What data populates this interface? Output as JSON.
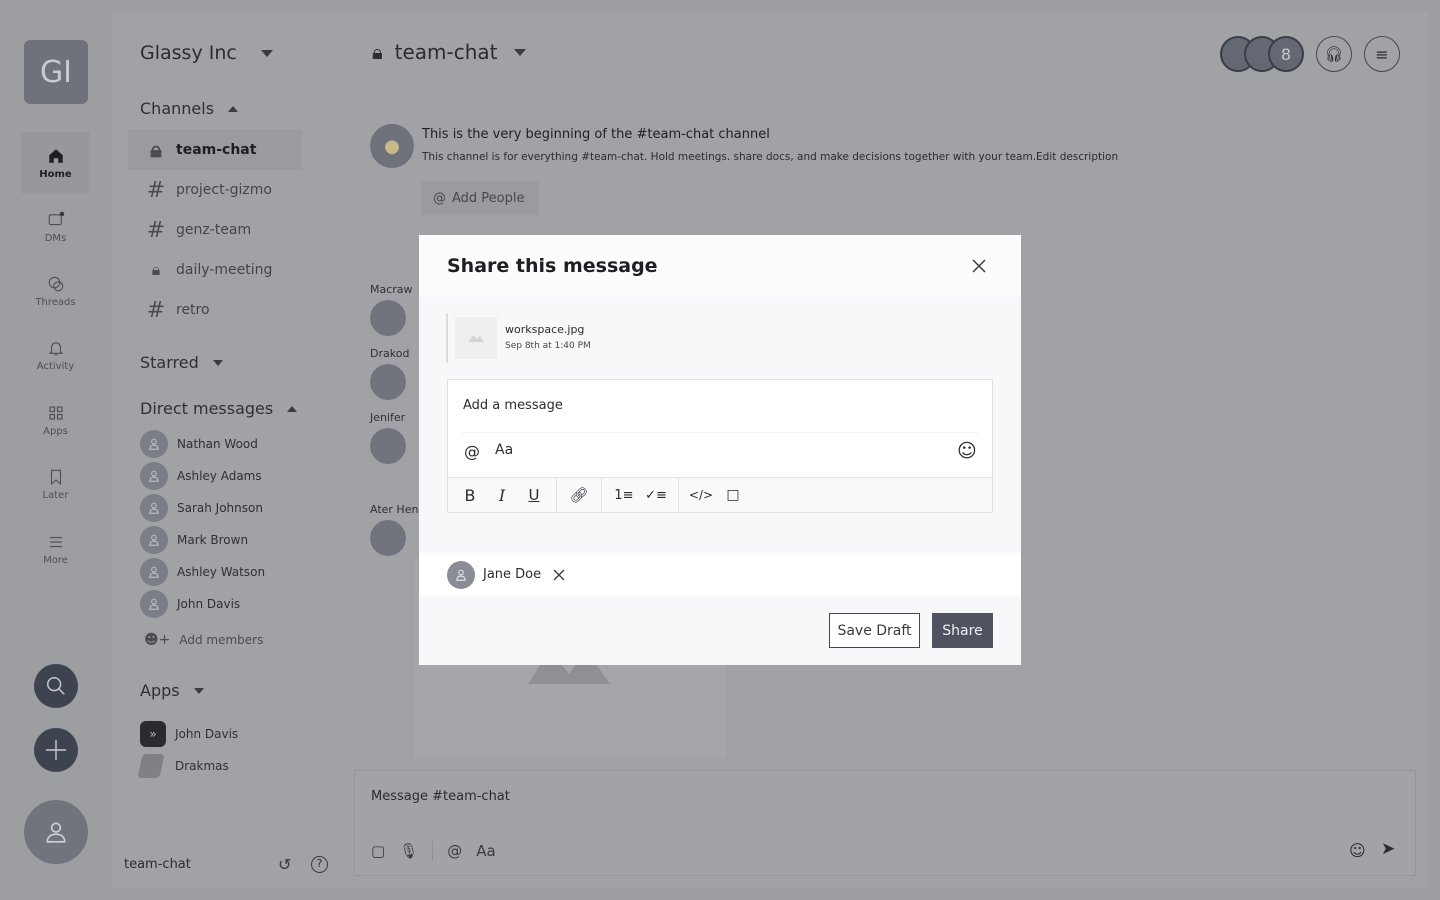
{
  "workspace": {
    "initials": "GI",
    "name": "Glassy Inc"
  },
  "rail": [
    {
      "label": "Home",
      "icon": "home-icon"
    },
    {
      "label": "DMs",
      "icon": "dm-icon"
    },
    {
      "label": "Threads",
      "icon": "threads-icon"
    },
    {
      "label": "Activity",
      "icon": "bell-icon"
    },
    {
      "label": "Apps",
      "icon": "apps-icon"
    },
    {
      "label": "Later",
      "icon": "bookmark-icon"
    },
    {
      "label": "More",
      "icon": "menu-icon"
    }
  ],
  "sidebar": {
    "channels_label": "Channels",
    "channels": [
      {
        "name": "team-chat",
        "private": true
      },
      {
        "name": "project-gizmo",
        "private": false
      },
      {
        "name": "genz-team",
        "private": false
      },
      {
        "name": "daily-meeting",
        "private": true
      },
      {
        "name": "retro",
        "private": false
      }
    ],
    "starred_label": "Starred",
    "dm_label": "Direct messages",
    "dms": [
      "Nathan Wood",
      "Ashley Adams",
      "Sarah Johnson",
      "Mark Brown",
      "Ashley Watson",
      "John Davis"
    ],
    "add_members": "Add members",
    "apps_label": "Apps",
    "apps": [
      "John Davis",
      "Drakmas"
    ],
    "footer_channel": "team-chat"
  },
  "header": {
    "channel": "team-chat",
    "member_count": "8"
  },
  "intro": {
    "title": "This is the very beginning of the #team-chat  channel",
    "description": "This channel is for everything #team-chat. Hold meetings. share docs, and make decisions together with your team.Edit description",
    "add_people": "Add People"
  },
  "messages": [
    "Macraw",
    "Drakod",
    "Jenifer",
    "Ater Henr"
  ],
  "composer": {
    "placeholder": "Message #team-chat",
    "aa": "Aa"
  },
  "modal": {
    "title": "Share this message",
    "file_name": "workspace.jpg",
    "file_time": "Sep 8th at 1:40 PM",
    "message_placeholder": "Add a message",
    "aa": "Aa",
    "recipient": "Jane Doe",
    "save_draft": "Save Draft",
    "share": "Share"
  }
}
